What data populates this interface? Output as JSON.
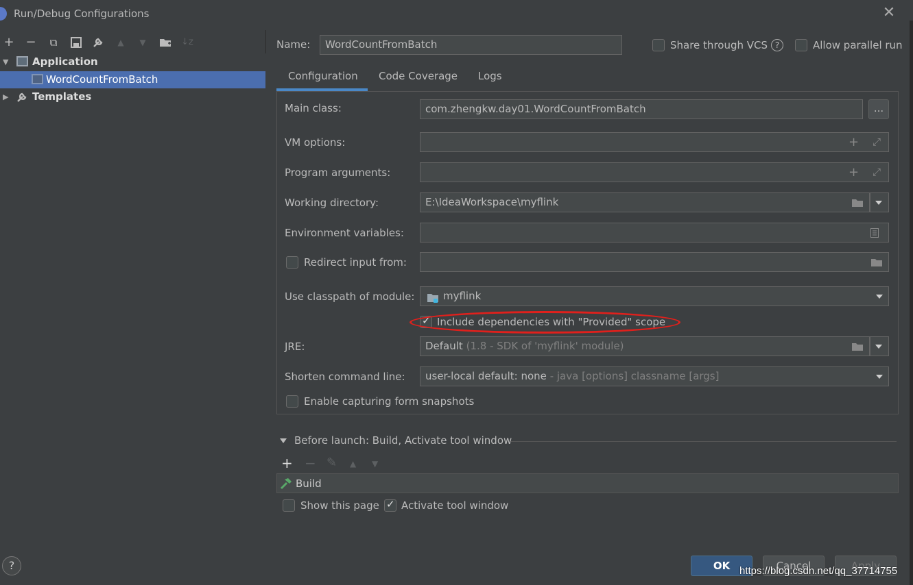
{
  "window": {
    "title": "Run/Debug Configurations",
    "close_glyph": "✕"
  },
  "toolbar": {
    "add": "+",
    "remove": "−",
    "copy": "⧉",
    "save": "▬",
    "edit": "🔧",
    "up": "▲",
    "down": "▼",
    "folder": "📁",
    "sort": "↓z"
  },
  "tree": {
    "application": "Application",
    "config_item": "WordCountFromBatch",
    "templates": "Templates"
  },
  "name": {
    "label": "Name:",
    "value": "WordCountFromBatch"
  },
  "share_vcs": {
    "label": "Share through VCS",
    "checked": false
  },
  "help_icon": "?",
  "allow_parallel": {
    "label": "Allow parallel run",
    "checked": false
  },
  "tabs": [
    {
      "label": "Configuration",
      "active": true
    },
    {
      "label": "Code Coverage",
      "active": false
    },
    {
      "label": "Logs",
      "active": false
    }
  ],
  "form": {
    "main_class": {
      "label": "Main class:",
      "value": "com.zhengkw.day01.WordCountFromBatch",
      "browse": "..."
    },
    "vm_options": {
      "label": "VM options:",
      "value": ""
    },
    "program_args": {
      "label": "Program arguments:",
      "value": ""
    },
    "working_dir": {
      "label": "Working directory:",
      "value": "E:\\IdeaWorkspace\\myflink"
    },
    "env_vars": {
      "label": "Environment variables:",
      "value": ""
    },
    "redirect_input": {
      "label": "Redirect input from:",
      "value": "",
      "checked": false
    },
    "classpath_module": {
      "label": "Use classpath of module:",
      "value": "myflink"
    },
    "include_provided": {
      "label": "Include dependencies with \"Provided\" scope",
      "checked": true
    },
    "jre": {
      "label": "JRE:",
      "value": "Default",
      "hint": "(1.8 - SDK of 'myflink' module)"
    },
    "shorten_cmd": {
      "label": "Shorten command line:",
      "value": "user-local default: none",
      "hint": "- java [options] classname [args]"
    },
    "capture_snapshots": {
      "label": "Enable capturing form snapshots",
      "checked": false
    }
  },
  "before_launch": {
    "header": "Before launch: Build, Activate tool window",
    "tools": {
      "add": "+",
      "remove": "−",
      "edit": "✎",
      "up": "▲",
      "down": "▼"
    },
    "items": [
      "Build"
    ],
    "show_page": {
      "label": "Show this page",
      "checked": false
    },
    "activate_tool": {
      "label": "Activate tool window",
      "checked": true
    }
  },
  "buttons": {
    "ok": "OK",
    "cancel": "Cancel",
    "apply": "Apply"
  },
  "watermark": "https://blog.csdn.net/qq_37714755",
  "colors": {
    "background": "#3c3f41",
    "selection": "#4b6eaf",
    "accent": "#4a88c7",
    "highlight_ellipse": "#e0201c"
  }
}
